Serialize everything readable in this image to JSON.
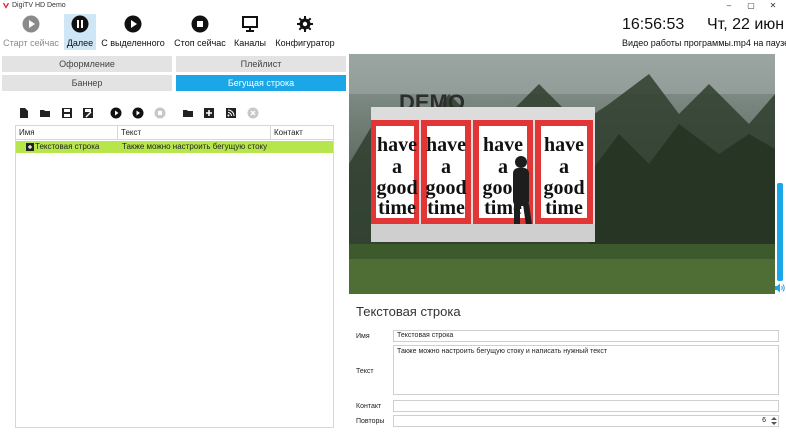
{
  "window": {
    "title": "DigiTV HD Demo"
  },
  "toolbar": {
    "buttons": [
      {
        "label": "Старт сейчас",
        "icon": "play-circle-icon"
      },
      {
        "label": "Далее",
        "icon": "pause-circle-icon"
      },
      {
        "label": "С выделенного",
        "icon": "play-circle-icon"
      },
      {
        "label": "Стоп сейчас",
        "icon": "stop-circle-icon"
      },
      {
        "label": "Каналы",
        "icon": "monitor-icon"
      },
      {
        "label": "Конфигуратор",
        "icon": "gear-icon"
      }
    ]
  },
  "header": {
    "clock": "16:56:53",
    "date": "Чт, 22 июн",
    "status": "Видео работы программы.mp4 на паузе"
  },
  "tabs": {
    "row1": [
      "Оформление",
      "Плейлист"
    ],
    "row2": [
      "Баннер",
      "Бегущая строка"
    ]
  },
  "table": {
    "columns": [
      "Имя",
      "Текст",
      "Контакт"
    ],
    "rows": [
      {
        "name": "Текстовая строка",
        "text": "Также можно настроить бегущую стоку и",
        "contact": ""
      }
    ]
  },
  "preview": {
    "watermark": "DEMO",
    "poster_text": [
      "have",
      "a",
      "good",
      "time"
    ]
  },
  "form": {
    "title": "Текстовая строка",
    "name_label": "Имя",
    "name_value": "Текстовая строка",
    "text_label": "Текст",
    "text_value": "Также можно настроить бегущую стоку и написать нужный текст",
    "contact_label": "Контакт",
    "contact_value": "",
    "repeats_label": "Повторы",
    "repeats_value": "6"
  }
}
